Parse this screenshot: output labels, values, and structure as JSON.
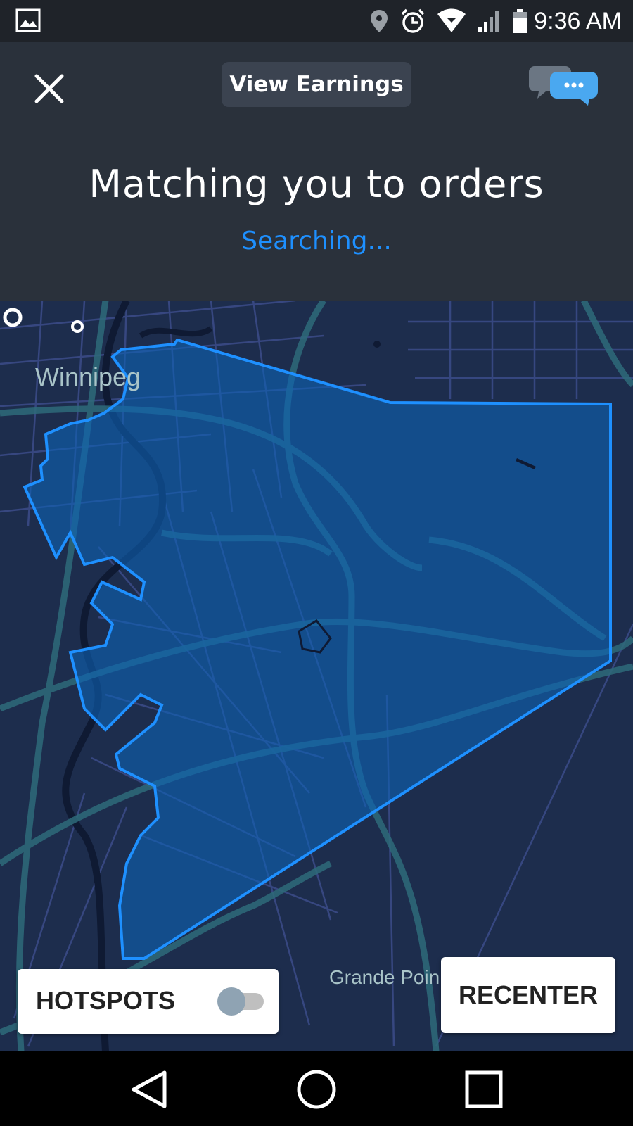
{
  "status_bar": {
    "time": "9:36 AM",
    "icons": [
      "gallery-icon",
      "location-icon",
      "alarm-icon",
      "wifi-icon",
      "signal-icon",
      "battery-icon"
    ]
  },
  "header": {
    "earnings_label": "View Earnings",
    "title": "Matching you to orders",
    "subtitle": "Searching...",
    "colors": {
      "background": "#2a313b",
      "accent": "#1e90ff"
    }
  },
  "map": {
    "city_label": "Winnipeg",
    "area_label": "Grande Poin",
    "zone_color": "#1e90ff"
  },
  "controls": {
    "hotspots_label": "HOTSPOTS",
    "hotspots_enabled": false,
    "recenter_label": "RECENTER"
  },
  "nav": {
    "buttons": [
      "back-icon",
      "home-icon",
      "recents-icon"
    ]
  }
}
